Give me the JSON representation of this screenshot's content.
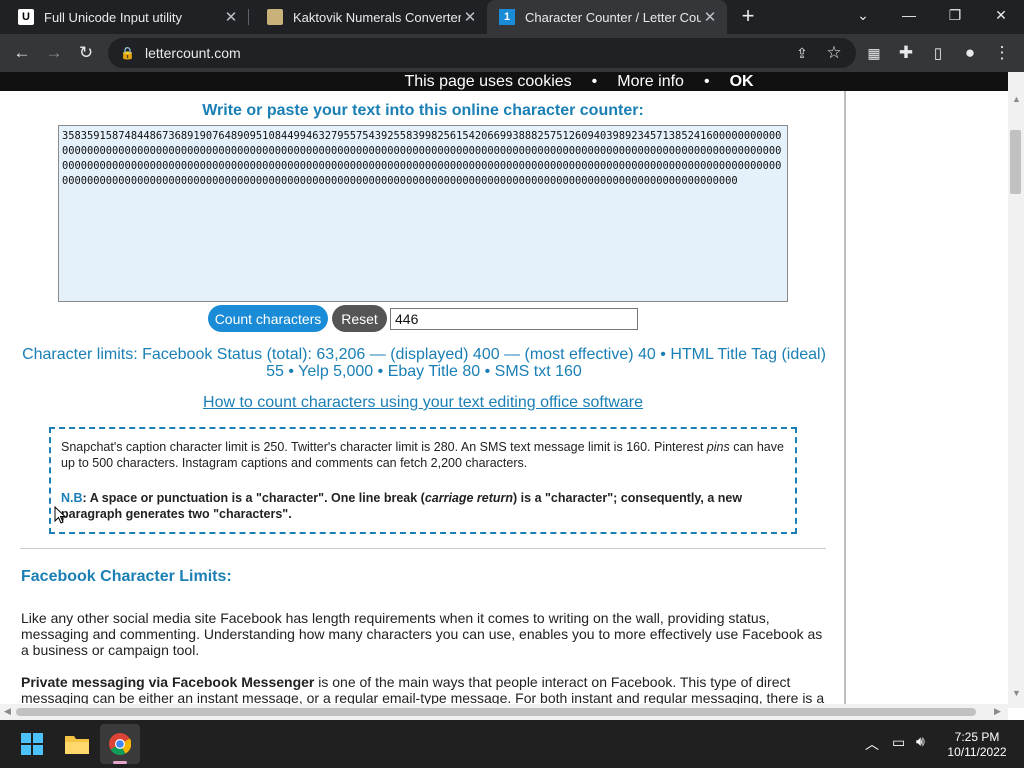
{
  "tabs": [
    {
      "title": "Full Unicode Input utility",
      "favicon": "U"
    },
    {
      "title": "Kaktovik Numerals Converter - O",
      "favicon": "img"
    },
    {
      "title": "Character Counter / Letter Count",
      "favicon": "1"
    }
  ],
  "omnibox": {
    "url": "lettercount.com"
  },
  "cookie_banner": {
    "text": "This page uses cookies",
    "sep": "•",
    "more_info": "More info",
    "ok": "OK"
  },
  "main": {
    "heading": "Write or paste your text into this online character counter:",
    "textarea_value": "358359158748448673689190764890951084499463279557543925583998256154206699388825751260940398923457138524160000000000000000000000000000000000000000000000000000000000000000000000000000000000000000000000000000000000000000000000000000000000000000000000000000000000000000000000000000000000000000000000000000000000000000000000000000000000000000000000000000000000000000000000000000000000000000000000000000000000000000000000000000000000000000000000000000000000000",
    "count_button": "Count characters",
    "reset_button": "Reset",
    "count_value": "446",
    "limits_text": "Character limits: Facebook Status (total): 63,206 — (displayed) 400 — (most effective) 40 • HTML Title Tag (ideal) 55 • Yelp 5,000 • Ebay Title 80 • SMS txt 160",
    "howto_link": "How to count characters using your text editing office software",
    "note_p1_a": "Snapchat's caption character limit is 250. Twitter's character limit is 280. An SMS text message limit is 160. Pinterest ",
    "note_p1_em": "pins",
    "note_p1_b": " can have up to 500 characters. Instagram captions and comments can fetch 2,200 characters.",
    "nb_label": "N.B",
    "nb_a": ": A space or punctuation is a \"character\". One line break (",
    "nb_em": "carriage return",
    "nb_b": ") is a \"character\"; consequently, a new paragraph generates two \"characters\".",
    "fb_heading": "Facebook Character Limits:",
    "para1": "Like any other social media site Facebook has length requirements when it comes to writing on the wall, providing status, messaging and commenting. Understanding how many characters you can use, enables you to more effectively use Facebook as a business or campaign tool.",
    "para2_bold": "Private messaging via Facebook Messenger",
    "para2_rest": " is one of the main ways that people interact on Facebook. This type of direct messaging can be either an instant message, or a regular email-type message. For both instant and regular messaging, there is a"
  },
  "taskbar": {
    "time": "7:25 PM",
    "date": "10/11/2022"
  }
}
